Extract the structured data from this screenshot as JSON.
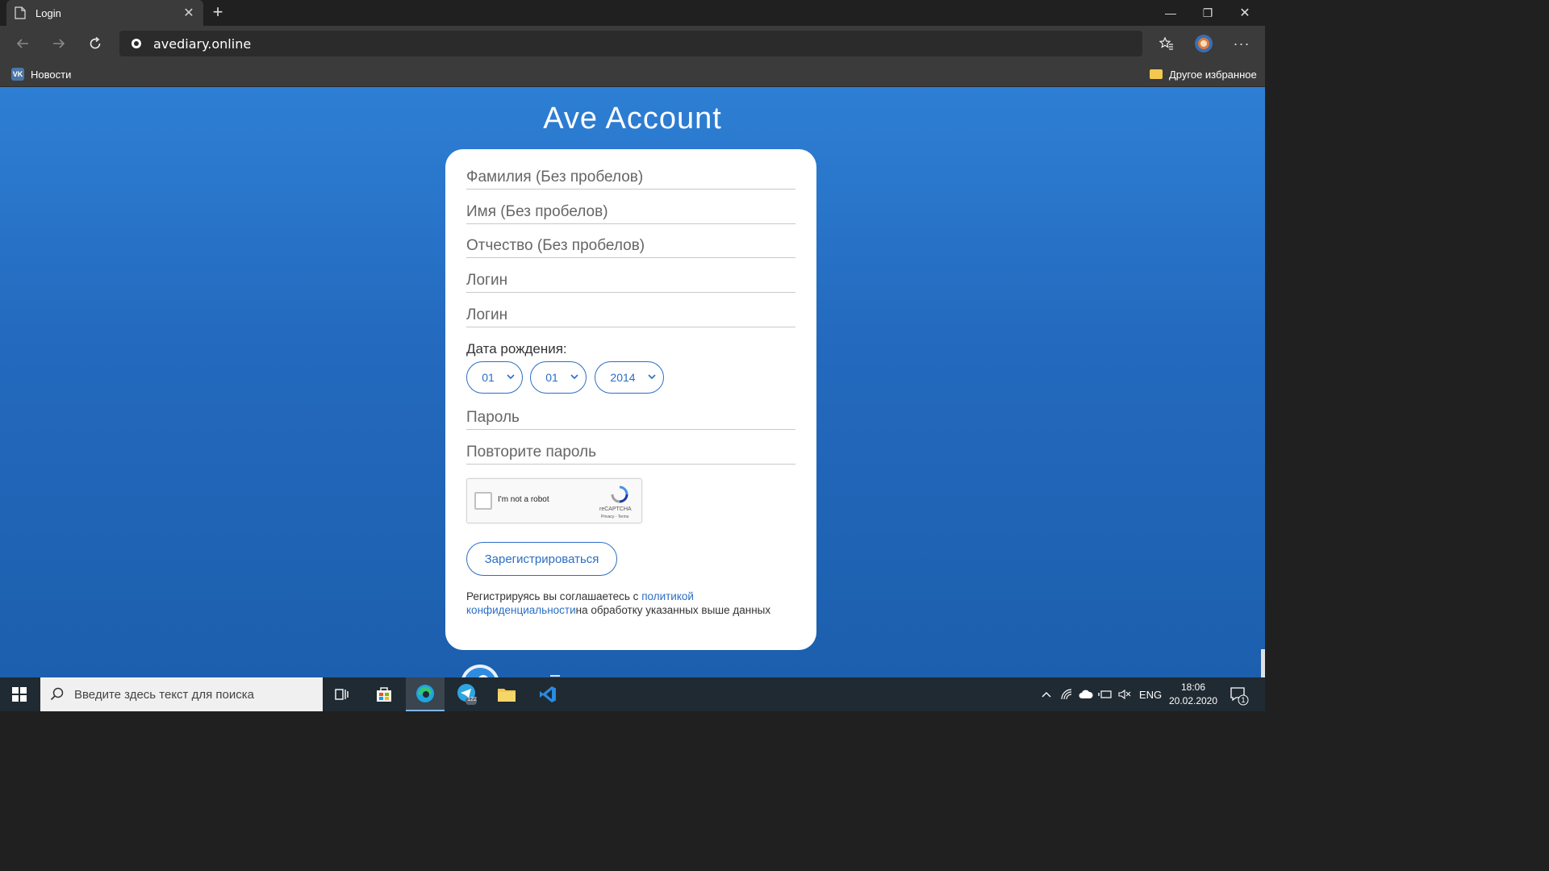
{
  "browser": {
    "tab_title": "Login",
    "new_tab": "+",
    "url": "avediary.online",
    "bookmarks": [
      {
        "label": "Новости",
        "icon": "vk-icon"
      },
      {
        "label": "Другое избранное",
        "icon": "folder-icon"
      }
    ]
  },
  "page": {
    "title": "Ave Account",
    "fields": [
      {
        "placeholder": "Фамилия (Без пробелов)"
      },
      {
        "placeholder": "Имя (Без пробелов)"
      },
      {
        "placeholder": "Отчество (Без пробелов)"
      },
      {
        "placeholder": "Логин"
      },
      {
        "placeholder": "Логин"
      }
    ],
    "dob_label": "Дата рождения:",
    "dob": {
      "day": "01",
      "month": "01",
      "year": "2014"
    },
    "password_placeholder": "Пароль",
    "password_repeat_placeholder": "Повторите пароль",
    "captcha": {
      "label": "I'm not a robot",
      "brand": "reCAPTCHA",
      "links": "Privacy - Terms"
    },
    "submit_label": "Зарегистрироваться",
    "policy": {
      "prefix": "Регистрируясь вы соглашаетесь с ",
      "link": "политикой конфиденциальности",
      "suffix": "на обработку указанных выше данных"
    }
  },
  "taskbar": {
    "search_placeholder": "Введите здесь текст для поиска",
    "telegram_badge": "122",
    "language": "ENG",
    "time": "18:06",
    "date": "20.02.2020",
    "notification_count": "1"
  },
  "colors": {
    "accent": "#2a6ec4",
    "page_bg": "#2369bd"
  }
}
